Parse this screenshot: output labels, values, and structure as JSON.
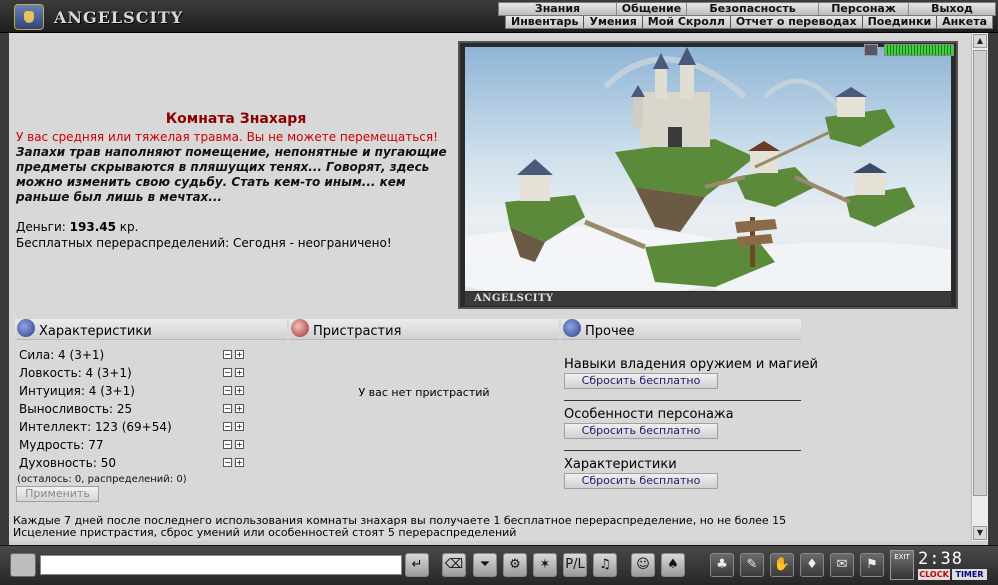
{
  "app": {
    "brand": "ANGELSCITY"
  },
  "menu_main": [
    "Знания",
    "Общение",
    "Безопасность",
    "Персонаж",
    "Выход"
  ],
  "menu_sub": [
    "Инвентарь",
    "Умения",
    "Мой Скролл",
    "Отчет о переводах",
    "Поединки",
    "Анкета"
  ],
  "room": {
    "title": "Комната Знахаря",
    "trauma_warning": "У вас средняя или тяжелая травма. Вы не можете перемещаться!",
    "flavor": "Запахи трав наполняют помещение, непонятные и пугающие предметы скрываются в пляшущих тенях... Говорят, здесь можно изменить свою судьбу. Стать кем-то иным... кем раньше был лишь в мечтах...",
    "money_label": "Деньги:",
    "money_value": "193.45",
    "money_unit": "кр.",
    "free_redist": "Бесплатных перераспределений: Сегодня - неограничено!"
  },
  "picture": {
    "caption": "ANGELSCITY",
    "health_fraction": 1.0
  },
  "sections": {
    "stats": {
      "title": "Характеристики",
      "rows": [
        {
          "label": "Сила: 4 (3+1)"
        },
        {
          "label": "Ловкость: 4 (3+1)"
        },
        {
          "label": "Интуиция: 4 (3+1)"
        },
        {
          "label": "Выносливость: 25"
        },
        {
          "label": "Интеллект: 123 (69+54)"
        },
        {
          "label": "Мудрость: 77"
        },
        {
          "label": "Духовность: 50"
        }
      ],
      "remaining": "(осталось: 0, распределений: 0)",
      "apply_label": "Применить"
    },
    "addictions": {
      "title": "Пристрастия",
      "empty_text": "У вас нет пристрастий"
    },
    "other": {
      "title": "Прочее",
      "items": [
        {
          "label": "Навыки владения оружием и магией",
          "button": "Сбросить бесплатно"
        },
        {
          "label": "Особенности персонажа",
          "button": "Сбросить бесплатно"
        },
        {
          "label": "Характеристики",
          "button": "Сбросить бесплатно"
        }
      ]
    }
  },
  "notes": [
    "Каждые 7 дней после последнего использования комнаты знахаря вы получаете 1 бесплатное перераспределение, но не более 15",
    "Исцеление пристрастия, сброс умений или особенностей стоят 5 перераспределений"
  ],
  "bottom": {
    "exit_label": "EXIT",
    "clock_time": "2:38",
    "clock_label": "CLOCK",
    "timer_label": "TIMER",
    "tools": [
      "enter-icon",
      "eraser-icon",
      "filter-icon",
      "fight-icon",
      "pl-icon",
      "sound-icon",
      "smile-icon",
      "mask-icon",
      "bag-icon",
      "scroll-icon",
      "hand-icon",
      "shield-icon",
      "gift-icon",
      "flag-icon"
    ]
  }
}
